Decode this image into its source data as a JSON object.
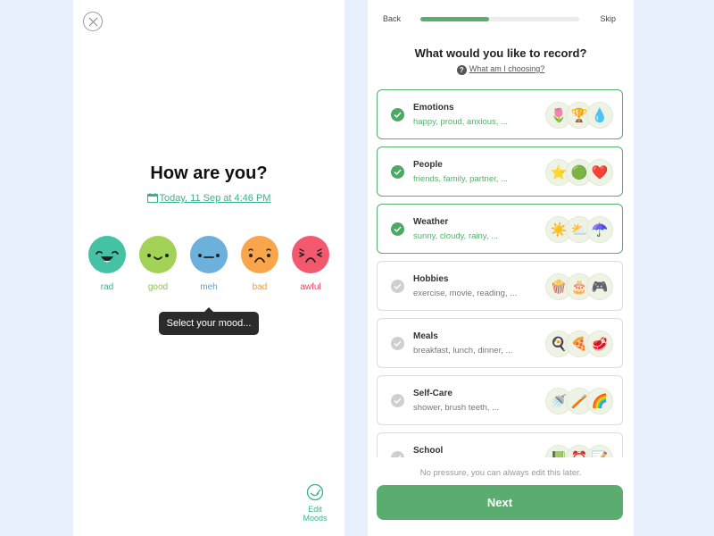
{
  "left_screen": {
    "close_icon": "close-icon",
    "title": "How are you?",
    "date_label": "Today, 11 Sep at 4:46 PM",
    "moods": [
      {
        "label": "rad",
        "color": "#45c1a4",
        "label_color": "#3bb08f",
        "expression": "laughing"
      },
      {
        "label": "good",
        "color": "#a2d356",
        "label_color": "#8cc63f",
        "expression": "smile"
      },
      {
        "label": "meh",
        "color": "#6bb1dc",
        "label_color": "#5aa5d6",
        "expression": "neutral"
      },
      {
        "label": "bad",
        "color": "#f9a54c",
        "label_color": "#f39b38",
        "expression": "sad"
      },
      {
        "label": "awful",
        "color": "#f2596f",
        "label_color": "#e94560",
        "expression": "distressed"
      }
    ],
    "tooltip": "Select your mood...",
    "edit_moods": {
      "line1": "Edit",
      "line2": "Moods"
    }
  },
  "right_screen": {
    "back_label": "Back",
    "skip_label": "Skip",
    "progress_percent": 43,
    "title": "What would you like to record?",
    "help_link": "What am I choosing?",
    "categories": [
      {
        "name": "Emotions",
        "examples": "happy, proud, anxious, ...",
        "selected": true,
        "icons": [
          "🌷",
          "🏆",
          "💧"
        ]
      },
      {
        "name": "People",
        "examples": "friends, family, partner, ...",
        "selected": true,
        "icons": [
          "⭐",
          "🟢",
          "❤️"
        ]
      },
      {
        "name": "Weather",
        "examples": "sunny, cloudy, rainy, ...",
        "selected": true,
        "icons": [
          "☀️",
          "⛅",
          "☂️"
        ]
      },
      {
        "name": "Hobbies",
        "examples": "exercise, movie, reading, ...",
        "selected": false,
        "icons": [
          "🍿",
          "🎂",
          "🎮"
        ]
      },
      {
        "name": "Meals",
        "examples": "breakfast, lunch, dinner, ...",
        "selected": false,
        "icons": [
          "🍳",
          "🍕",
          "🥩"
        ]
      },
      {
        "name": "Self-Care",
        "examples": "shower, brush teeth, ...",
        "selected": false,
        "icons": [
          "🚿",
          "🪥",
          "🌈"
        ]
      },
      {
        "name": "School",
        "examples": "",
        "selected": false,
        "icons": [
          "📗",
          "⏰",
          "📝"
        ]
      }
    ],
    "note": "No pressure, you can always edit this later.",
    "next_label": "Next",
    "accent_color": "#5aad6e"
  }
}
